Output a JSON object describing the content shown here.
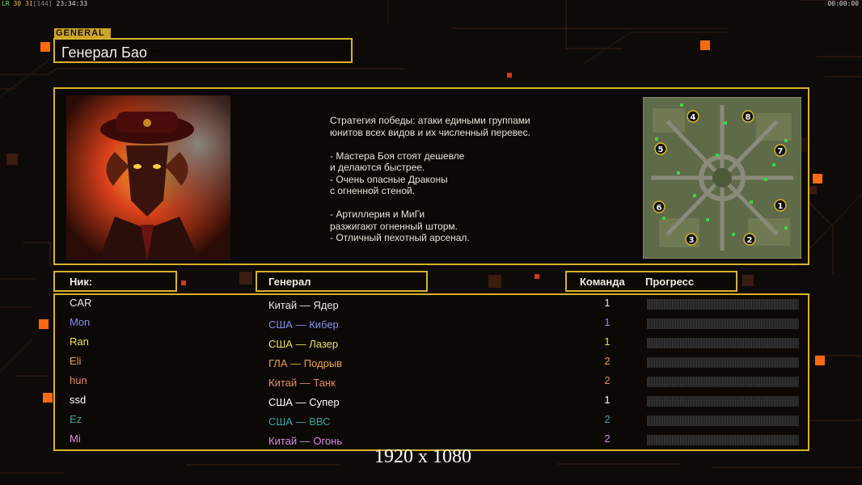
{
  "hud": {
    "left_prefix": "LR",
    "left_fps_a": "30",
    "left_fps_b": "31",
    "left_bracket": "[144]",
    "left_time": "23:34:33",
    "right_time": "00:00:00"
  },
  "general": {
    "tag": "GENERAL",
    "name": "Генерал Бао"
  },
  "description": [
    "Стратегия победы: атаки едиными группами",
    "юнитов всех видов и их численный перевес.",
    "",
    "- Мастера Боя стоят дешевле",
    "и делаются быстрее.",
    "- Очень опасные Драконы",
    "с огненной стеной.",
    "",
    "- Артиллерия и МиГи",
    "разжигают огненный шторм.",
    "- Отличный пехотный арсенал."
  ],
  "minimap": {
    "start_positions": [
      "4",
      "8",
      "5",
      "7",
      "6",
      "1",
      "3",
      "2"
    ]
  },
  "table": {
    "headers": {
      "nick": "Ник:",
      "general": "Генерал",
      "team": "Команда",
      "progress": "Прогресс"
    },
    "rows": [
      {
        "nick": "CAR",
        "general": "Китай — Ядер",
        "team": "1",
        "color": "#e8e8e8"
      },
      {
        "nick": "Mon",
        "general": "США — Кибер",
        "team": "1",
        "color": "#8a8cf0"
      },
      {
        "nick": "Ran",
        "general": "США — Лазер",
        "team": "1",
        "color": "#e6e25a"
      },
      {
        "nick": "Eli",
        "general": "ГЛА — Подрыв",
        "team": "2",
        "color": "#f0a040"
      },
      {
        "nick": "hun",
        "general": "Китай — Танк",
        "team": "2",
        "color": "#e48a66"
      },
      {
        "nick": "ssd",
        "general": "США — Супер",
        "team": "1",
        "color": "#ffffff"
      },
      {
        "nick": "Ez",
        "general": "США — ВВС",
        "team": "2",
        "color": "#3aa7a7"
      },
      {
        "nick": "Mi",
        "general": "Китай — Огонь",
        "team": "2",
        "color": "#d88ae4"
      }
    ]
  },
  "overlay": {
    "resolution": "1920 x 1080"
  },
  "colors": {
    "accent": "#d6b32a",
    "background": "#0e0a07",
    "orange_square": "#ff6a10"
  }
}
